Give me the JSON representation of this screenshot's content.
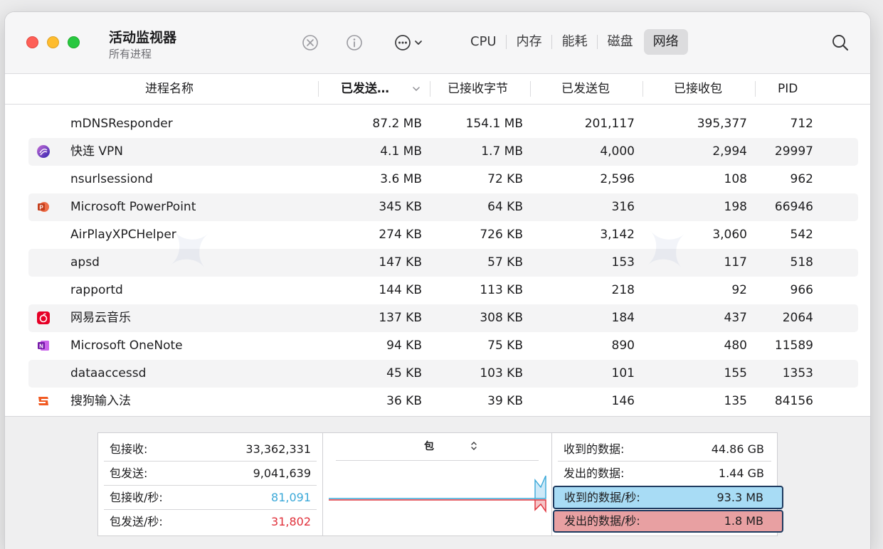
{
  "window": {
    "title": "活动监视器",
    "subtitle": "所有进程"
  },
  "toolbar": {
    "stop_icon": "x-circle-icon",
    "info_icon": "info-icon",
    "more_icon": "ellipsis-circle-icon",
    "search_icon": "search-icon",
    "tabs": [
      {
        "label": "CPU",
        "active": false
      },
      {
        "label": "内存",
        "active": false
      },
      {
        "label": "能耗",
        "active": false
      },
      {
        "label": "磁盘",
        "active": false
      },
      {
        "label": "网络",
        "active": true
      }
    ]
  },
  "table": {
    "columns": {
      "name": "进程名称",
      "sent": "已发送…",
      "received_bytes": "已接收字节",
      "sent_packets": "已发送包",
      "received_packets": "已接收包",
      "pid": "PID"
    },
    "rows": [
      {
        "name": "mDNSResponder",
        "icon": "none",
        "sent": "87.2 MB",
        "rcvd": "154.1 MB",
        "spkt": "201,117",
        "rpkt": "395,377",
        "pid": "712"
      },
      {
        "name": "快连 VPN",
        "icon": "vpn-app-icon",
        "sent": "4.1 MB",
        "rcvd": "1.7 MB",
        "spkt": "4,000",
        "rpkt": "2,994",
        "pid": "29997"
      },
      {
        "name": "nsurlsessiond",
        "icon": "none",
        "sent": "3.6 MB",
        "rcvd": "72 KB",
        "spkt": "2,596",
        "rpkt": "108",
        "pid": "962"
      },
      {
        "name": "Microsoft PowerPoint",
        "icon": "powerpoint-icon",
        "sent": "345 KB",
        "rcvd": "64 KB",
        "spkt": "316",
        "rpkt": "198",
        "pid": "66946"
      },
      {
        "name": "AirPlayXPCHelper",
        "icon": "none",
        "sent": "274 KB",
        "rcvd": "726 KB",
        "spkt": "3,142",
        "rpkt": "3,060",
        "pid": "542"
      },
      {
        "name": "apsd",
        "icon": "none",
        "sent": "147 KB",
        "rcvd": "57 KB",
        "spkt": "153",
        "rpkt": "117",
        "pid": "518"
      },
      {
        "name": "rapportd",
        "icon": "none",
        "sent": "144 KB",
        "rcvd": "113 KB",
        "spkt": "218",
        "rpkt": "92",
        "pid": "966"
      },
      {
        "name": "网易云音乐",
        "icon": "netease-music-icon",
        "sent": "137 KB",
        "rcvd": "308 KB",
        "spkt": "184",
        "rpkt": "437",
        "pid": "2064"
      },
      {
        "name": "Microsoft OneNote",
        "icon": "onenote-icon",
        "sent": "94 KB",
        "rcvd": "75 KB",
        "spkt": "890",
        "rpkt": "480",
        "pid": "11589"
      },
      {
        "name": "dataaccessd",
        "icon": "none",
        "sent": "45 KB",
        "rcvd": "103 KB",
        "spkt": "101",
        "rpkt": "155",
        "pid": "1353"
      },
      {
        "name": "搜狗输入法",
        "icon": "sogou-icon",
        "sent": "36 KB",
        "rcvd": "39 KB",
        "spkt": "146",
        "rpkt": "135",
        "pid": "84156"
      }
    ]
  },
  "summary": {
    "packets": [
      {
        "label": "包接收:",
        "value": "33,362,331",
        "color": "#1d1d1f"
      },
      {
        "label": "包发送:",
        "value": "9,041,639",
        "color": "#1d1d1f"
      },
      {
        "label": "包接收/秒:",
        "value": "81,091",
        "color": "#3aa8d8"
      },
      {
        "label": "包发送/秒:",
        "value": "31,802",
        "color": "#e0303a"
      }
    ],
    "graph_selector": "包",
    "data": [
      {
        "label": "收到的数据:",
        "value": "44.86 GB"
      },
      {
        "label": "发出的数据:",
        "value": "1.44 GB"
      },
      {
        "label": "收到的数据/秒:",
        "value": "93.3 MB"
      },
      {
        "label": "发出的数据/秒:",
        "value": "1.8 MB"
      }
    ]
  },
  "colors": {
    "received": "#3aa8d8",
    "sent": "#e0303a",
    "highlight_blue": "#a8dcf5",
    "highlight_red": "#e8a0a2"
  }
}
